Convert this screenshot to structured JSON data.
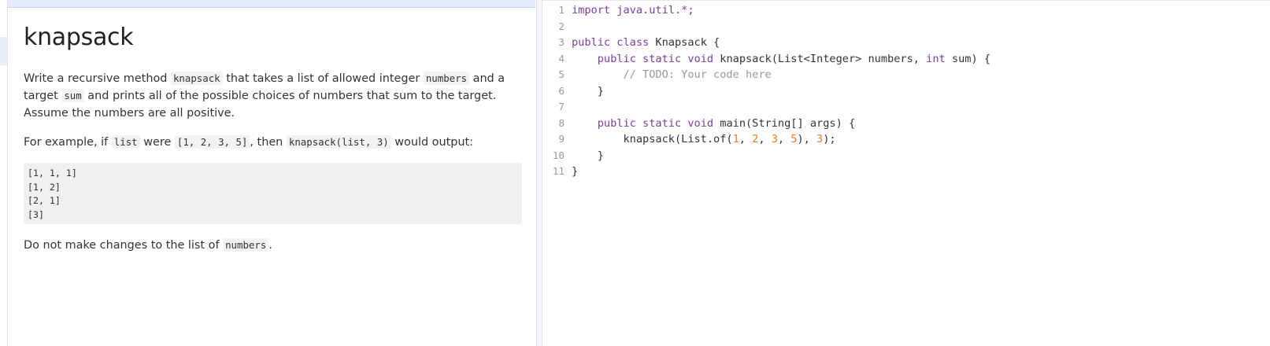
{
  "problem": {
    "title": "knapsack",
    "intro": {
      "t1": "Write a recursive method ",
      "c1": "knapsack",
      "t2": " that takes a list of allowed integer ",
      "c2": "numbers",
      "t3": " and a target ",
      "c3": "sum",
      "t4": " and prints all of the possible choices of numbers that sum to the target. Assume the numbers are all positive."
    },
    "example": {
      "t1": "For example, if ",
      "c1": "list",
      "t2": " were ",
      "c2": "[1, 2, 3, 5]",
      "t3": ", then ",
      "c3": "knapsack(list, 3)",
      "t4": " would output:"
    },
    "output_lines": [
      "[1, 1, 1]",
      "[1, 2]",
      "[2, 1]",
      "[3]"
    ],
    "note": {
      "t1": "Do not make changes to the list of ",
      "c1": "numbers",
      "t2": "."
    }
  },
  "editor": {
    "line_numbers": [
      "1",
      "2",
      "3",
      "4",
      "5",
      "6",
      "7",
      "8",
      "9",
      "10",
      "11"
    ],
    "code": {
      "l1": "import java.util.*;",
      "l3_kw": "public class",
      "l3_rest": " Knapsack {",
      "l4_indent": "    ",
      "l4_kw": "public static void",
      "l4_mid": " knapsack(List<Integer> numbers, ",
      "l4_kw2": "int",
      "l4_end": " sum) {",
      "l5_indent": "        ",
      "l5_comment": "// TODO: Your code here",
      "l6": "    }",
      "l8_indent": "    ",
      "l8_kw": "public static void",
      "l8_rest": " main(String[] args) {",
      "l9_pre": "        knapsack(List.of(",
      "l9_n1": "1",
      "l9_sep1": ", ",
      "l9_n2": "2",
      "l9_sep2": ", ",
      "l9_n3": "3",
      "l9_sep3": ", ",
      "l9_n4": "5",
      "l9_mid": "), ",
      "l9_n5": "3",
      "l9_end": ");",
      "l10": "    }",
      "l11": "}"
    }
  }
}
